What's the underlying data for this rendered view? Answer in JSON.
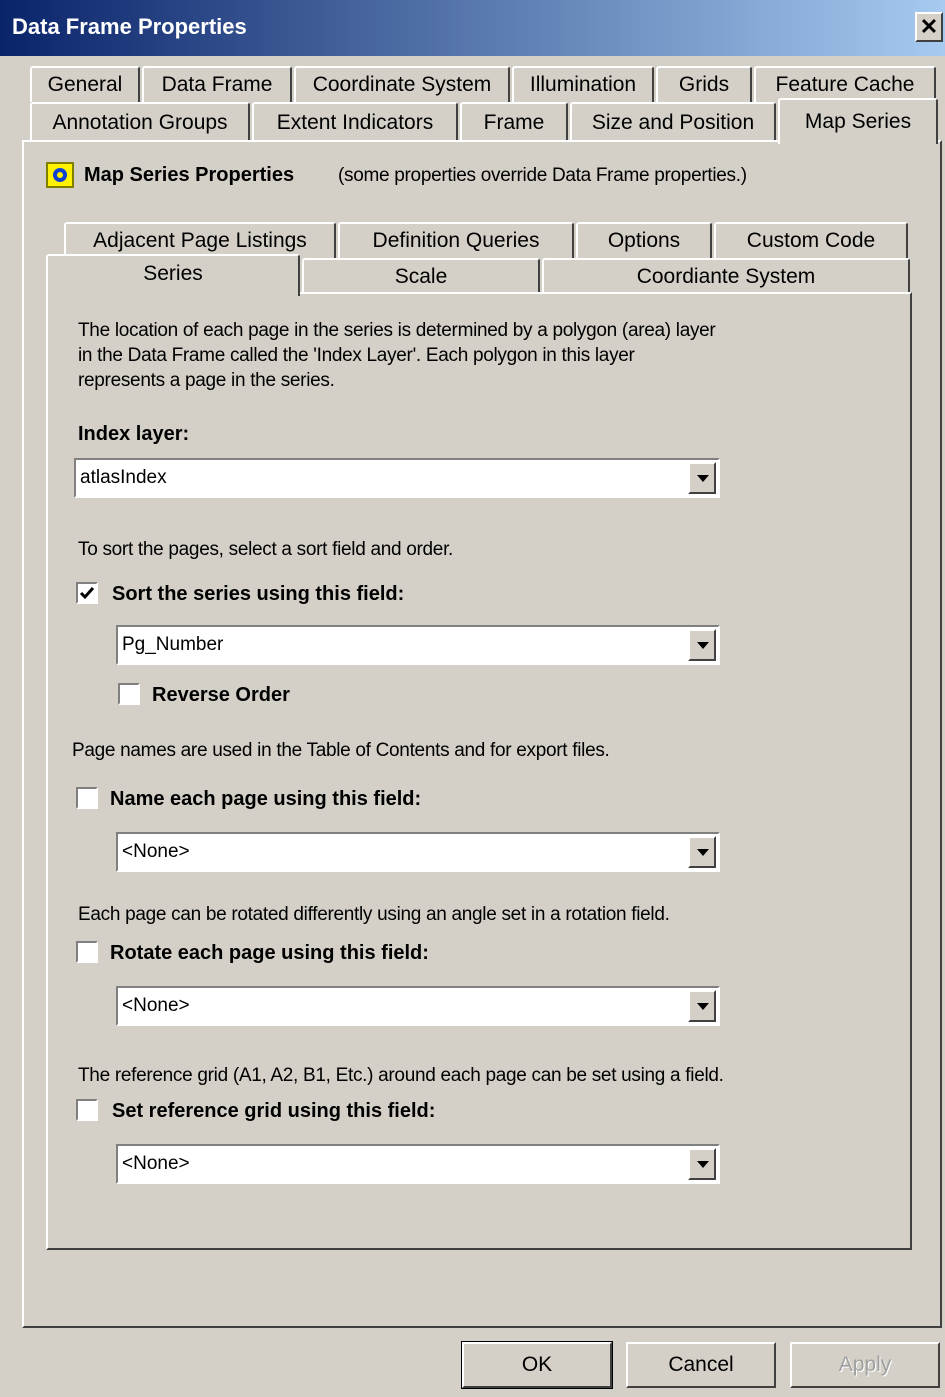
{
  "window": {
    "title": "Data Frame Properties",
    "close_glyph": "✕"
  },
  "outer_tabs": {
    "row1": [
      "General",
      "Data Frame",
      "Coordinate System",
      "Illumination",
      "Grids",
      "Feature Cache"
    ],
    "row2": [
      "Annotation Groups",
      "Extent Indicators",
      "Frame",
      "Size and Position",
      "Map Series"
    ],
    "active": "Map Series"
  },
  "header": {
    "icon": "map-series-icon",
    "title": "Map Series Properties",
    "note": "(some properties override Data Frame properties.)"
  },
  "inner_tabs": {
    "row1": [
      "Adjacent Page Listings",
      "Definition Queries",
      "Options",
      "Custom Code"
    ],
    "row2": [
      "Series",
      "Scale",
      "Coordiante System"
    ],
    "active": "Series"
  },
  "series": {
    "intro_lines": [
      "The location of each page in the series is determined by a polygon (area) layer",
      "in the Data Frame called the 'Index Layer'.  Each polygon in this layer",
      "represents a page in the series."
    ],
    "index_layer_label": "Index layer:",
    "index_layer_value": "atlasIndex",
    "sort_hint": "To sort the pages, select a sort field and order.",
    "sort_label": "Sort the series using this field:",
    "sort_checked": true,
    "sort_field_value": "Pg_Number",
    "reverse_label": "Reverse Order",
    "reverse_checked": false,
    "name_hint": "Page names are used in the Table of Contents and for export files.",
    "name_label": "Name each page using this field:",
    "name_checked": false,
    "name_field_value": "<None>",
    "rotate_hint": "Each page can be rotated differently using an angle set in a rotation field.",
    "rotate_label": "Rotate each page using this field:",
    "rotate_checked": false,
    "rotate_field_value": "<None>",
    "grid_hint": "The reference grid (A1, A2, B1, Etc.) around each page can be set using a field.",
    "grid_label": "Set reference grid using this field:",
    "grid_checked": false,
    "grid_field_value": "<None>"
  },
  "buttons": {
    "ok": "OK",
    "cancel": "Cancel",
    "apply": "Apply"
  }
}
